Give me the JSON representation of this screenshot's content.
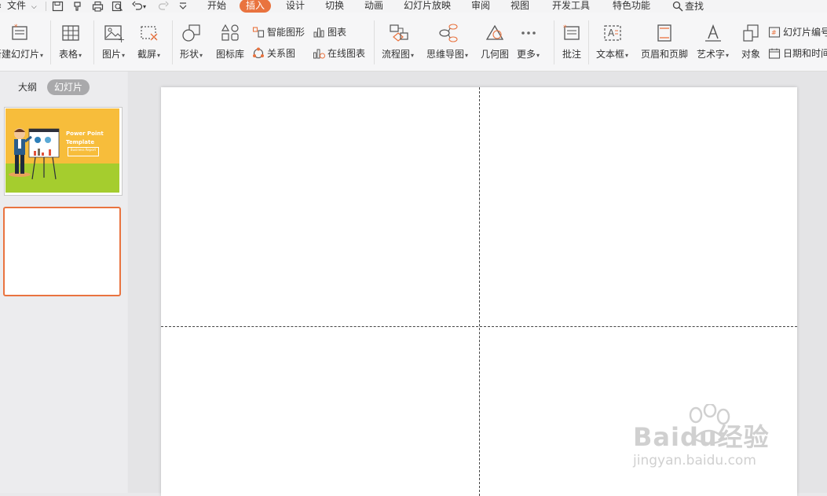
{
  "menu": {
    "file": "文件",
    "tabs": [
      "开始",
      "插入",
      "设计",
      "切换",
      "动画",
      "幻灯片放映",
      "审阅",
      "视图",
      "开发工具",
      "特色功能"
    ],
    "active_tab": "插入",
    "search": "查找"
  },
  "ribbon": {
    "new_slide": "新建幻灯片",
    "table": "表格",
    "picture": "图片",
    "screenshot": "截屏",
    "shape": "形状",
    "icon_lib": "图标库",
    "smart_art": "智能图形",
    "chart": "图表",
    "relation": "关系图",
    "online_chart": "在线图表",
    "flowchart": "流程图",
    "mindmap": "思维导图",
    "geometry": "几何图",
    "more": "更多",
    "comment": "批注",
    "textbox": "文本框",
    "header_footer": "页眉和页脚",
    "wordart": "艺术字",
    "object": "对象",
    "slide_number": "幻灯片编号",
    "datetime": "日期和时间"
  },
  "panel": {
    "outline_tab": "大纲",
    "slides_tab": "幻灯片"
  },
  "thumb1": {
    "title": "Power Point Template",
    "subtitle": "Business Report"
  },
  "watermark": {
    "brand": "Baidu经验",
    "url": "jingyan.baidu.com"
  },
  "colors": {
    "accent": "#e9733f",
    "thumb_yellow": "#f7bd3b",
    "thumb_green": "#a5cd2e"
  }
}
